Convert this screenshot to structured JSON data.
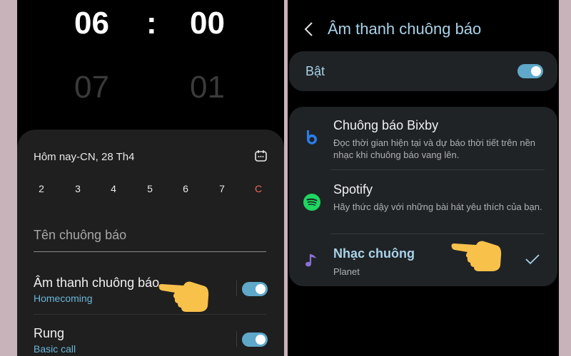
{
  "left_phone": {
    "time_selected": {
      "hour": "06",
      "colon": ":",
      "minute": "00"
    },
    "time_next": {
      "hour": "07",
      "minute": "01"
    },
    "date_label": "Hôm nay-CN, 28 Th4",
    "days": [
      "2",
      "3",
      "4",
      "5",
      "6",
      "7",
      "C"
    ],
    "alarm_name_placeholder": "Tên chuông báo",
    "alarm_sound": {
      "title": "Âm thanh chuông báo",
      "value": "Homecoming",
      "enabled": true
    },
    "vibration": {
      "title": "Rung",
      "value": "Basic call",
      "enabled": true
    }
  },
  "right_phone": {
    "title": "Âm thanh chuông báo",
    "master_toggle": {
      "label": "Bật",
      "enabled": true
    },
    "options": [
      {
        "title": "Chuông báo Bixby",
        "desc": "Đọc thời gian hiện tại và dự báo thời tiết trên nền nhạc khi chuông báo vang lên.",
        "icon": "bixby-icon"
      },
      {
        "title": "Spotify",
        "desc": "Hãy thức dậy với những bài hát yêu thích của bạn.",
        "icon": "spotify-icon"
      },
      {
        "title": "Nhạc chuông",
        "desc": "Planet",
        "icon": "music-note-icon",
        "selected": true
      }
    ]
  },
  "colors": {
    "accent_blue": "#a8d2e8",
    "toggle_on": "#5fa8c9",
    "sunday_red": "#e86a5b",
    "card_bg": "#1f1f1f",
    "hand_yellow": "#f8c14a"
  }
}
